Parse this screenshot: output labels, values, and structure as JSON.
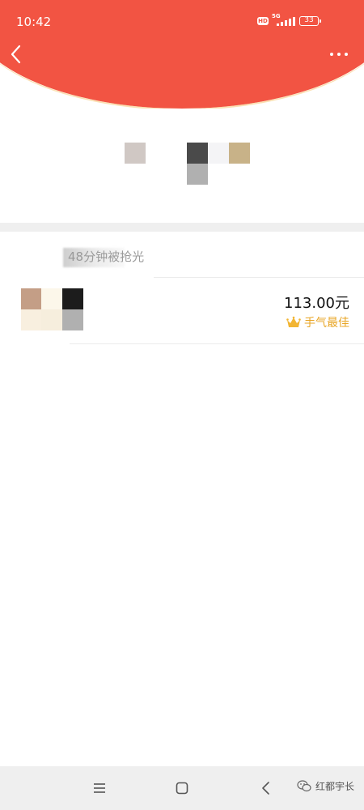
{
  "status_bar": {
    "time": "10:42",
    "hd_label": "HD",
    "network": "5G",
    "battery": "33"
  },
  "header": {
    "back_icon": "chevron-left-icon",
    "more_icon": "more-dots-icon",
    "accent_color": "#f25443"
  },
  "summary": {
    "text": "48分钟被抢光"
  },
  "record": {
    "amount": "113.00元",
    "badge": "手气最佳",
    "badge_color": "#e8a524",
    "badge_icon": "crown-icon"
  },
  "navbar": {
    "menu_icon": "menu-icon",
    "home_icon": "square-home-icon",
    "back_icon": "triangle-back-icon",
    "watermark": "红都宇长",
    "watermark_icon": "wechat-icon"
  }
}
